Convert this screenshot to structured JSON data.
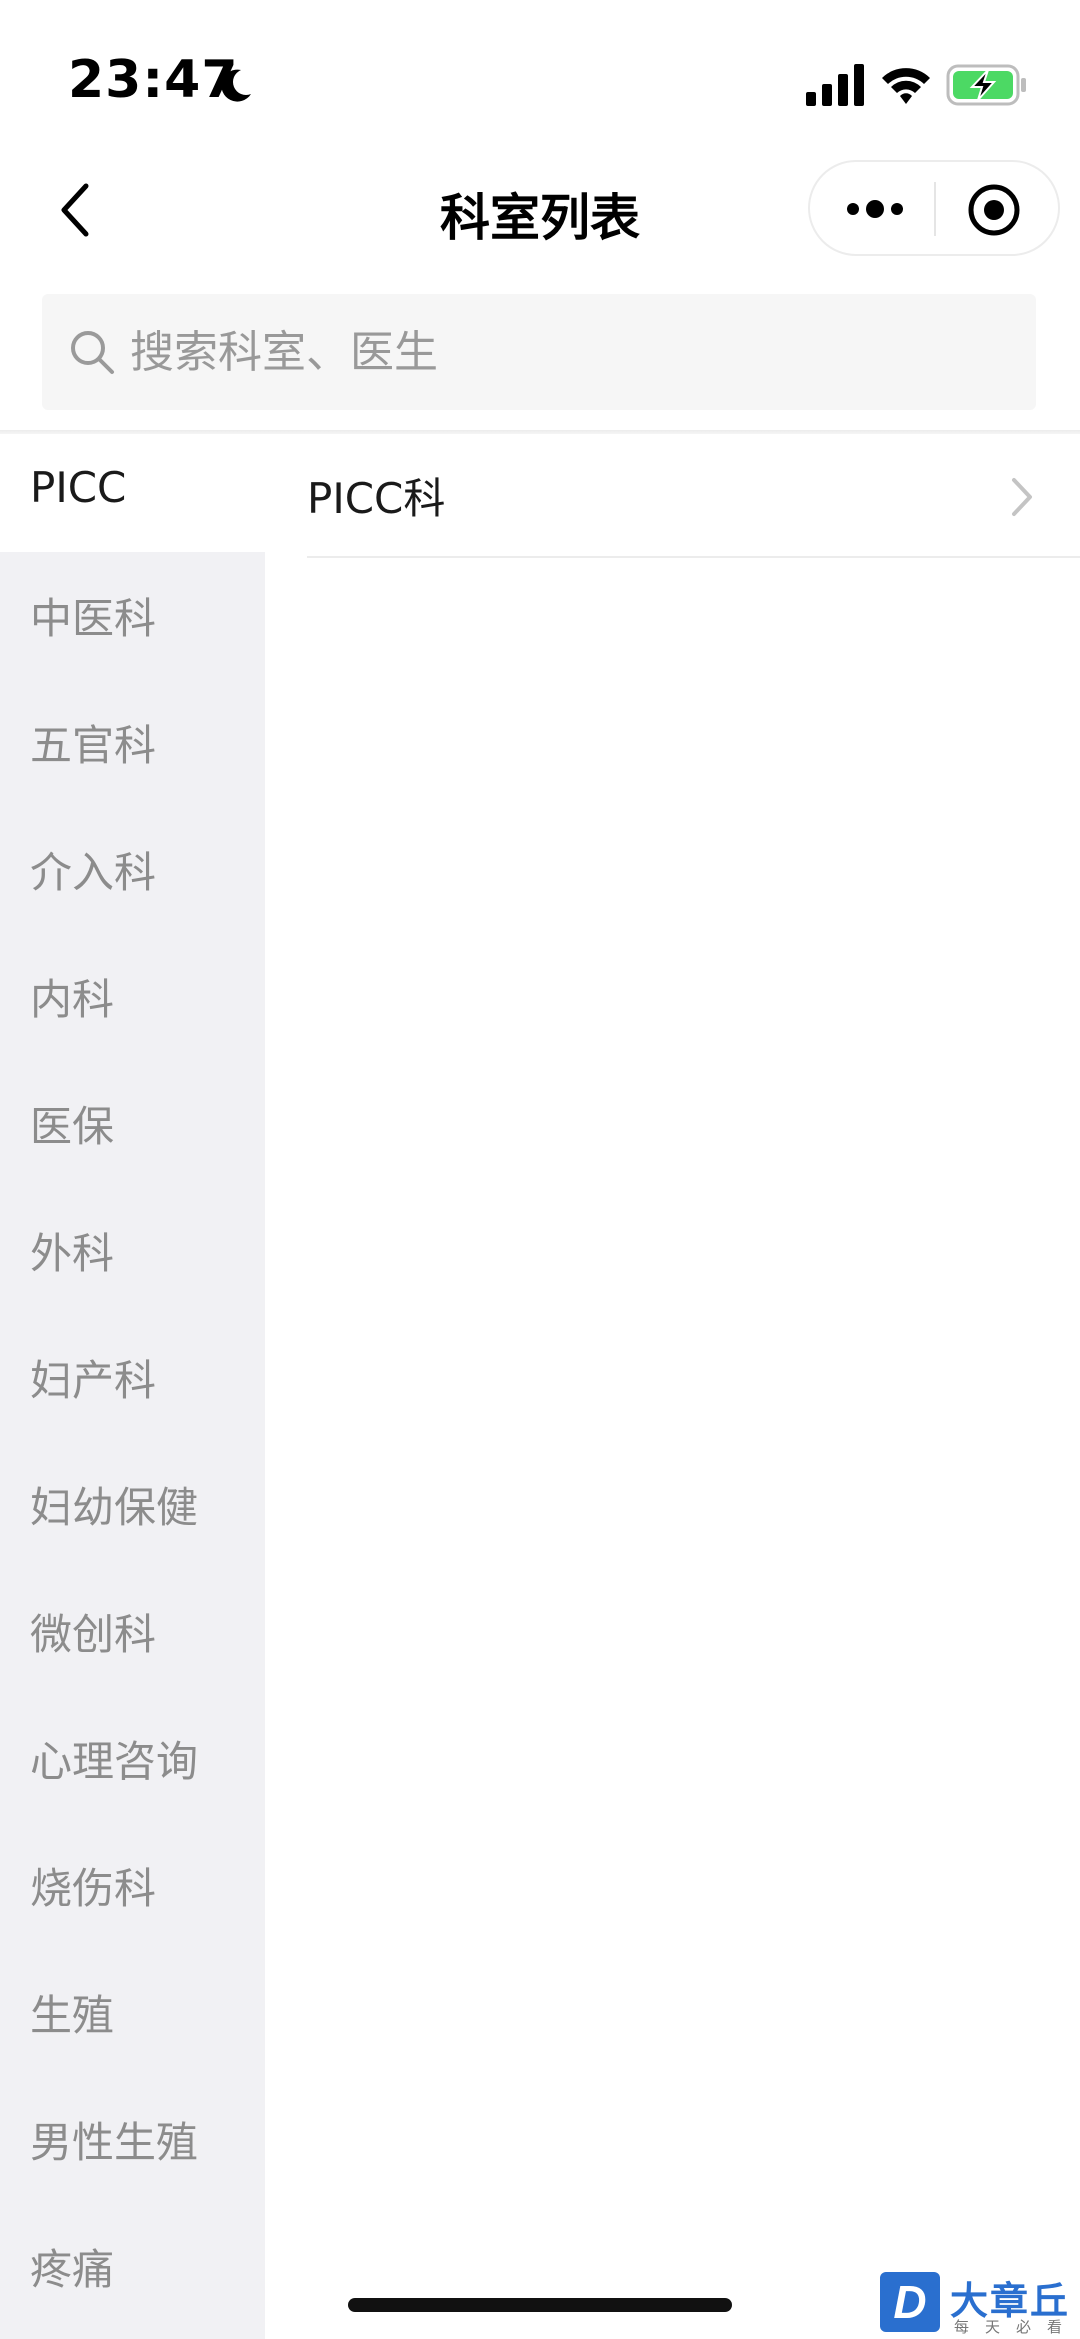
{
  "status_bar": {
    "time": "23:47",
    "focus_icon": "moon-icon",
    "signal_icon": "cellular-signal-icon",
    "wifi_icon": "wifi-icon",
    "battery_icon": "battery-charging-icon",
    "battery_color": "#4cd964"
  },
  "nav": {
    "back_icon": "chevron-left-icon",
    "title": "科室列表",
    "more_icon": "more-dots-icon",
    "close_icon": "target-circle-icon"
  },
  "search": {
    "icon": "search-icon",
    "placeholder": "搜索科室、医生",
    "value": ""
  },
  "departments": [
    {
      "label": "PICC",
      "active": true
    },
    {
      "label": "中医科",
      "active": false
    },
    {
      "label": "五官科",
      "active": false
    },
    {
      "label": "介入科",
      "active": false
    },
    {
      "label": "内科",
      "active": false
    },
    {
      "label": "医保",
      "active": false
    },
    {
      "label": "外科",
      "active": false
    },
    {
      "label": "妇产科",
      "active": false
    },
    {
      "label": "妇幼保健",
      "active": false
    },
    {
      "label": "微创科",
      "active": false
    },
    {
      "label": "心理咨询",
      "active": false
    },
    {
      "label": "烧伤科",
      "active": false
    },
    {
      "label": "生殖",
      "active": false
    },
    {
      "label": "男性生殖",
      "active": false
    },
    {
      "label": "疼痛",
      "active": false
    }
  ],
  "sub_departments": [
    {
      "label": "PICC科",
      "icon": "chevron-right-icon"
    }
  ],
  "watermark": {
    "logo_letter": "D",
    "name": "大章丘",
    "slogan": "每天必看"
  },
  "colors": {
    "menu_background": "#f1f1f4",
    "inactive_text": "#8c8c8c",
    "active_text": "#1a1a1a",
    "brand_blue": "#2a6fcf"
  }
}
